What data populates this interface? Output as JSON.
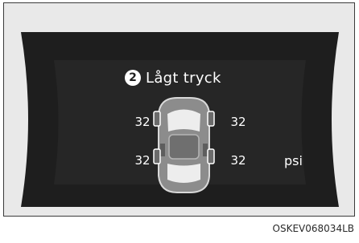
{
  "display": {
    "warning_number": "2",
    "warning_text": "Lågt tryck",
    "unit": "psi",
    "car_icon": "car-top-view-icon",
    "tires": {
      "front_left": "32",
      "front_right": "32",
      "rear_left": "32",
      "rear_right": "32"
    }
  },
  "caption": "OSKEV068034LB",
  "colors": {
    "panel_background": "#e9e9e9",
    "screen": "#1b1b1b",
    "text": "#ffffff"
  }
}
